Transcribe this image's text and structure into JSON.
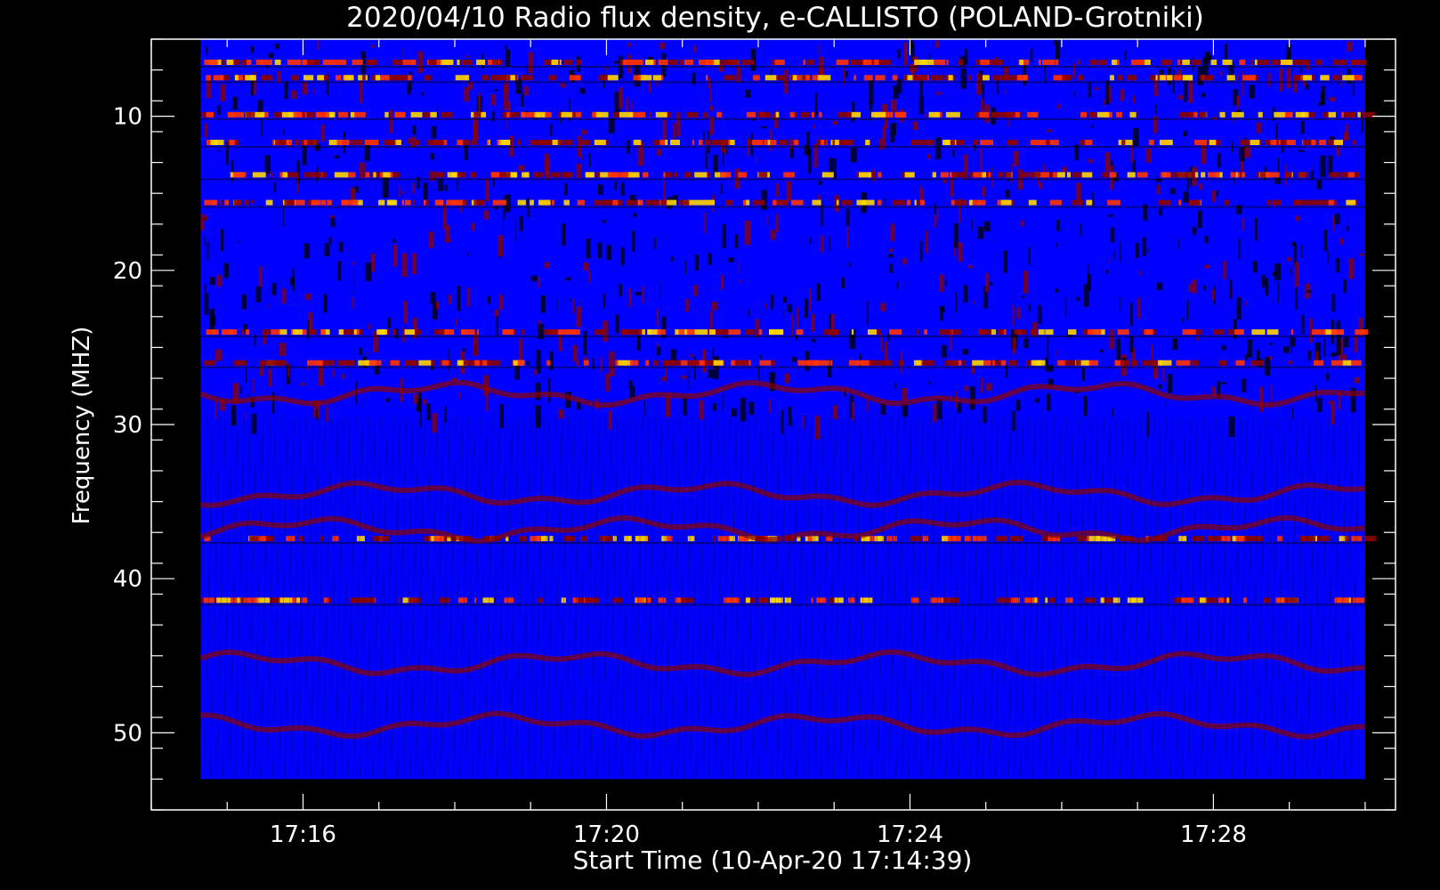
{
  "chart_data": {
    "type": "heatmap",
    "title": "2020/04/10  Radio flux density, e-CALLISTO (POLAND-Grotniki)",
    "xlabel": "Start Time (10-Apr-20 17:14:39)",
    "ylabel": "Frequency (MHZ)",
    "x_ticks": [
      "17:16",
      "17:20",
      "17:24",
      "17:28"
    ],
    "x_tick_minutes": [
      16,
      20,
      24,
      28
    ],
    "xlim_minutes": [
      14.0,
      30.4
    ],
    "y_ticks": [
      "10",
      "20",
      "30",
      "40",
      "50"
    ],
    "y_tick_values": [
      10,
      20,
      30,
      40,
      50
    ],
    "ylim": [
      5,
      55
    ],
    "data_x_range_minutes": [
      14.65,
      30.0
    ],
    "data_y_range_mhz": [
      5,
      53
    ],
    "y_inverted": true,
    "colormap": [
      "#000000",
      "#0000ff",
      "#8b0000",
      "#ff3300",
      "#ffd700"
    ],
    "strong_emission_bands_mhz": [
      6.5,
      7.5,
      9.9,
      11.7,
      13.8,
      15.6,
      24.0,
      26.0,
      37.4,
      41.4
    ],
    "wavy_bands_mhz": [
      28.0,
      34.5,
      36.8,
      45.5,
      49.5
    ],
    "grid": false,
    "background": "#000000",
    "foreground": "#ffffff"
  }
}
